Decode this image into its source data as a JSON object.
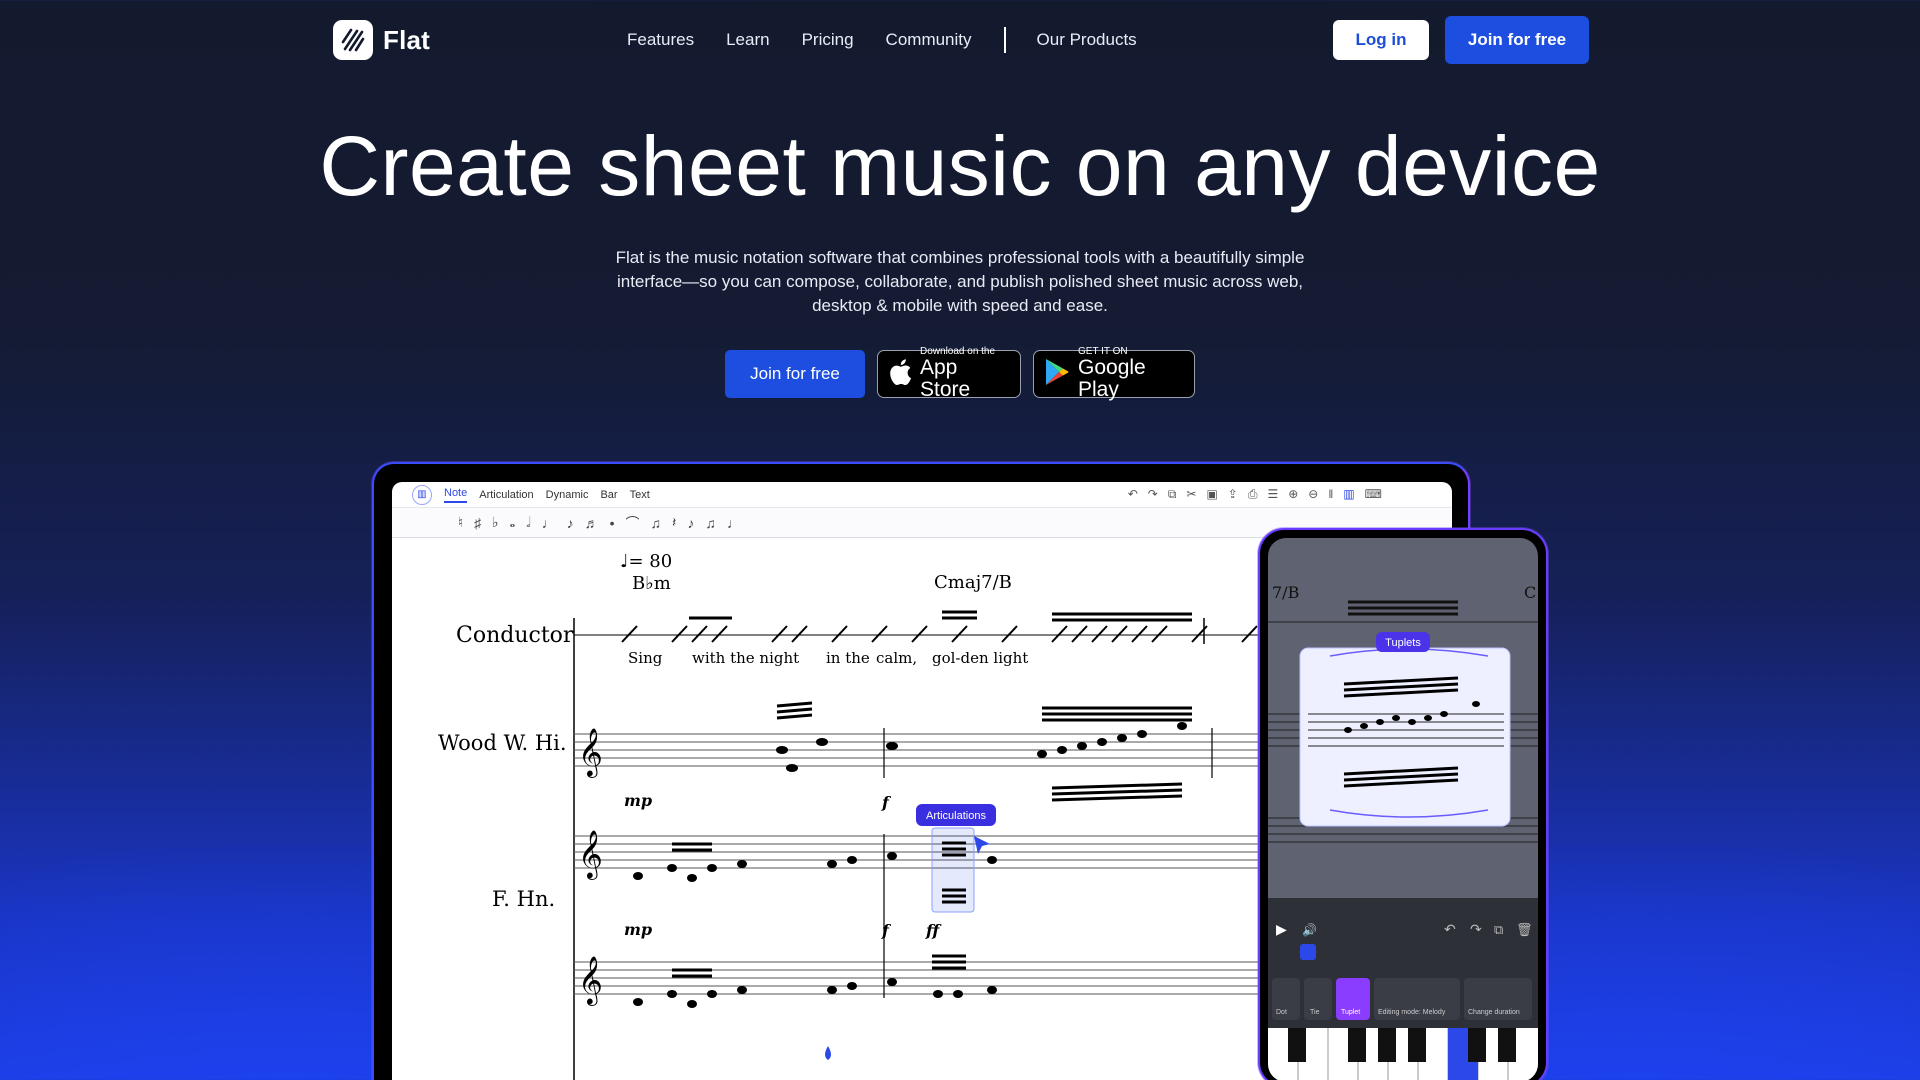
{
  "nav": {
    "brand": "Flat",
    "links": [
      "Features",
      "Learn",
      "Pricing",
      "Community"
    ],
    "our_products": "Our Products",
    "login": "Log in",
    "join": "Join for free"
  },
  "hero": {
    "title": "Create sheet music on any device",
    "subtitle": "Flat is the music notation software that combines professional tools with a beautifully simple interface—so you can compose, collaborate, and publish polished sheet music across web, desktop & mobile with speed and ease.",
    "cta": "Join for free",
    "app_store": {
      "small": "Download on the",
      "big": "App Store"
    },
    "google_play": {
      "small": "GET IT ON",
      "big": "Google Play"
    }
  },
  "editor": {
    "tabs": [
      "Note",
      "Articulation",
      "Dynamic",
      "Bar",
      "Text"
    ],
    "active_tab": "Note",
    "tempo": "♩= 80",
    "chord1": "B♭m",
    "chord2": "Cmaj7/B",
    "instruments": [
      "Conductor",
      "Wood W. Hi.",
      "F. Hn."
    ],
    "lyrics": [
      "Sing",
      "with the night",
      "in the",
      "calm,",
      "gol-den light"
    ],
    "dynamics": [
      "mp",
      "f",
      "ff",
      "mp",
      "f",
      "ff"
    ],
    "tooltip": "Articulations",
    "accent_color": "#2c48e8"
  },
  "phone": {
    "chord": "7/B",
    "tooltip": "Tuplets",
    "tools": [
      "Dot",
      "Tie",
      "Tuplet",
      "Editing mode: Melody",
      "Change duration"
    ]
  }
}
